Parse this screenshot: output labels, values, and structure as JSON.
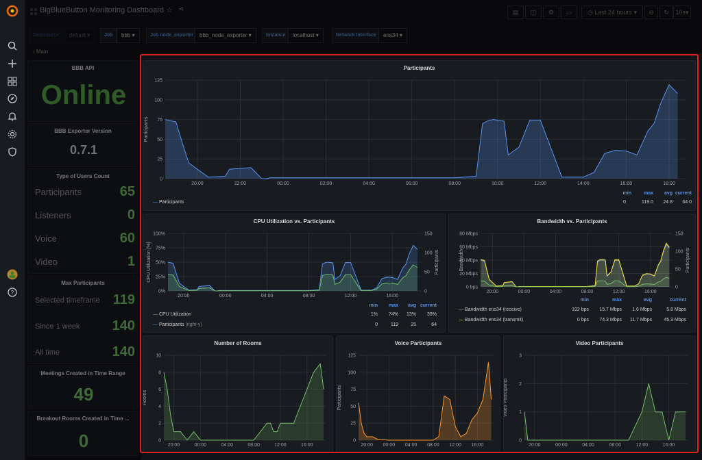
{
  "header": {
    "title": "BigBlueButton Monitoring Dashboard",
    "time_range": "Last 24 hours",
    "refresh": "10s"
  },
  "variables": [
    {
      "label": "Datasource",
      "value": "default"
    },
    {
      "label": "Job",
      "value": "bbb"
    },
    {
      "label": "Job node_exporter",
      "value": "bbb_node_exporter"
    },
    {
      "label": "Instance",
      "value": "localhost"
    },
    {
      "label": "Network Interface",
      "value": "ens34"
    }
  ],
  "row_title": "Main",
  "left": {
    "api_title": "BBB API",
    "api_status": "Online",
    "exporter_title": "BBB Exporter Version",
    "exporter_version": "0.7.1",
    "users_title": "Type of Users Count",
    "users": [
      {
        "label": "Participants",
        "value": "65"
      },
      {
        "label": "Listeners",
        "value": "0"
      },
      {
        "label": "Voice",
        "value": "60"
      },
      {
        "label": "Video",
        "value": "1"
      }
    ],
    "max_title": "Max Participants",
    "max": [
      {
        "label": "Selected timeframe",
        "value": "119"
      },
      {
        "label": "Since 1 week",
        "value": "140"
      },
      {
        "label": "All time",
        "value": "140"
      }
    ],
    "meetings_title": "Meetings Created in Time Range",
    "meetings_value": "49",
    "breakout_title": "Breakout Rooms Created in Time ...",
    "breakout_value": "0"
  },
  "colors": {
    "accent": "#5794f2",
    "green": "#73bf69",
    "orange": "#ff9830",
    "yellow": "#fade2a",
    "highlight": "#e02020"
  },
  "icons": [
    "grafana-logo-icon",
    "search-icon",
    "plus-icon",
    "dashboards-icon",
    "explore-icon",
    "alerting-icon",
    "gear-icon",
    "shield-icon",
    "avatar",
    "help-icon"
  ],
  "participants_chart": {
    "title": "Participants",
    "ylabel": "Participants",
    "yticks": [
      "0",
      "25",
      "50",
      "75",
      "100",
      "125"
    ],
    "xticks": [
      "20:00",
      "22:00",
      "00:00",
      "02:00",
      "04:00",
      "06:00",
      "08:00",
      "10:00",
      "12:00",
      "14:00",
      "16:00",
      "18:00"
    ],
    "legend_headers": [
      "min",
      "max",
      "avg",
      "current"
    ],
    "legend": [
      {
        "name": "Participants",
        "min": "0",
        "max": "119.0",
        "avg": "24.8",
        "current": "64.0"
      }
    ]
  },
  "cpu_chart": {
    "title": "CPU Utilization vs. Participants",
    "ylabel": "CPU Utilization [%]",
    "ylabel_right": "Participants",
    "yticks": [
      "0%",
      "25%",
      "50%",
      "75%",
      "100%"
    ],
    "yticks_right": [
      "0",
      "50",
      "100",
      "150"
    ],
    "xticks": [
      "20:00",
      "00:00",
      "04:00",
      "08:00",
      "12:00",
      "16:00"
    ],
    "legend_headers": [
      "min",
      "max",
      "avg",
      "current"
    ],
    "legend": [
      {
        "name": "CPU Utilization",
        "suffix": "",
        "min": "1%",
        "max": "74%",
        "avg": "13%",
        "current": "39%"
      },
      {
        "name": "Participants",
        "suffix": "(right-y)",
        "min": "0",
        "max": "119",
        "avg": "25",
        "current": "64"
      }
    ]
  },
  "bandwidth_chart": {
    "title": "Bandwidth vs. Participants",
    "ylabel": "Bandwidth",
    "ylabel_right": "Participants",
    "yticks": [
      "0 bps",
      "20 Mbps",
      "40 Mbps",
      "60 Mbps",
      "80 Mbps"
    ],
    "yticks_right": [
      "0",
      "50",
      "100",
      "150"
    ],
    "xticks": [
      "20:00",
      "00:00",
      "04:00",
      "08:00",
      "12:00",
      "16:00"
    ],
    "legend_headers": [
      "min",
      "max",
      "avg",
      "current"
    ],
    "legend": [
      {
        "name": "Bandwidth ens34 (receive)",
        "min": "192 bps",
        "max": "15.7 Mbps",
        "avg": "1.6 Mbps",
        "current": "5.8 Mbps"
      },
      {
        "name": "Bandwidth ens34 (transmit)",
        "min": "0 bps",
        "max": "74.3 Mbps",
        "avg": "11.7 Mbps",
        "current": "45.3 Mbps"
      }
    ]
  },
  "rooms_chart": {
    "title": "Number of Rooms",
    "ylabel": "Rooms",
    "yticks": [
      "0",
      "2",
      "4",
      "6",
      "8",
      "10"
    ],
    "xticks": [
      "20:00",
      "00:00",
      "04:00",
      "08:00",
      "12:00",
      "16:00"
    ]
  },
  "voice_chart": {
    "title": "Voice Participants",
    "ylabel": "Participants",
    "yticks": [
      "0",
      "25",
      "50",
      "75",
      "100",
      "125"
    ],
    "xticks": [
      "20:00",
      "00:00",
      "04:00",
      "08:00",
      "12:00",
      "16:00"
    ]
  },
  "video_chart": {
    "title": "Video Participants",
    "ylabel": "Video Participants",
    "yticks": [
      "0",
      "1",
      "2",
      "3"
    ],
    "xticks": [
      "20:00",
      "00:00",
      "04:00",
      "08:00",
      "12:00",
      "16:00"
    ]
  },
  "chart_data": [
    {
      "type": "area",
      "title": "Participants",
      "ylabel": "Participants",
      "ylim": [
        0,
        125
      ],
      "x_hours": [
        18.5,
        19.0,
        19.3,
        19.6,
        20.2,
        20.5,
        21.3,
        21.5,
        22.5,
        22.5,
        23.0,
        23.2,
        23.4,
        23.5,
        24.0,
        30.0,
        32.0,
        33.0,
        33.3,
        33.6,
        33.8,
        34.3,
        34.5,
        35.0,
        35.5,
        36.0,
        37.0,
        37.2,
        38.0,
        38.5,
        39.0,
        39.5,
        40.0,
        40.5,
        41.0,
        41.3,
        41.6,
        42.0,
        42.4
      ],
      "values": [
        75,
        72,
        45,
        20,
        8,
        2,
        3,
        12,
        14,
        14,
        0,
        0,
        1,
        1,
        1,
        1,
        1,
        3,
        70,
        74,
        75,
        73,
        30,
        40,
        74,
        74,
        2,
        2,
        2,
        8,
        32,
        36,
        35,
        30,
        60,
        70,
        95,
        119,
        108
      ],
      "series_name": "Participants"
    },
    {
      "type": "area",
      "title": "Number of Rooms",
      "ylim": [
        0,
        10
      ],
      "x_hours": [
        18.5,
        19,
        19.5,
        20,
        21,
        22,
        23,
        24,
        30,
        31,
        32,
        33,
        34,
        34.5,
        35,
        35.5,
        36,
        37,
        38,
        39,
        40,
        41,
        42,
        42.5
      ],
      "values": [
        8,
        6,
        3,
        1,
        1,
        0,
        1,
        0,
        0,
        0,
        0,
        1,
        2,
        2,
        1,
        1,
        2,
        2,
        2,
        4,
        6,
        8,
        9,
        6
      ]
    },
    {
      "type": "area",
      "title": "Voice Participants",
      "ylim": [
        0,
        125
      ],
      "x_hours": [
        18.5,
        19,
        19.5,
        20,
        21,
        22,
        24,
        30,
        32,
        33,
        34,
        35,
        36,
        37,
        38,
        39,
        40,
        41,
        42,
        42.5
      ],
      "values": [
        55,
        25,
        10,
        5,
        5,
        1,
        0,
        0,
        0,
        5,
        65,
        60,
        20,
        5,
        10,
        30,
        40,
        60,
        115,
        60
      ]
    },
    {
      "type": "area",
      "title": "Video Participants",
      "ylim": [
        0,
        3
      ],
      "x_hours": [
        18.5,
        19,
        20,
        24,
        30,
        34,
        36,
        37,
        38,
        39,
        40,
        41,
        42,
        42.5
      ],
      "values": [
        1,
        0,
        0,
        0,
        0,
        0,
        1,
        2,
        1,
        1,
        0,
        1,
        1,
        1
      ]
    }
  ]
}
